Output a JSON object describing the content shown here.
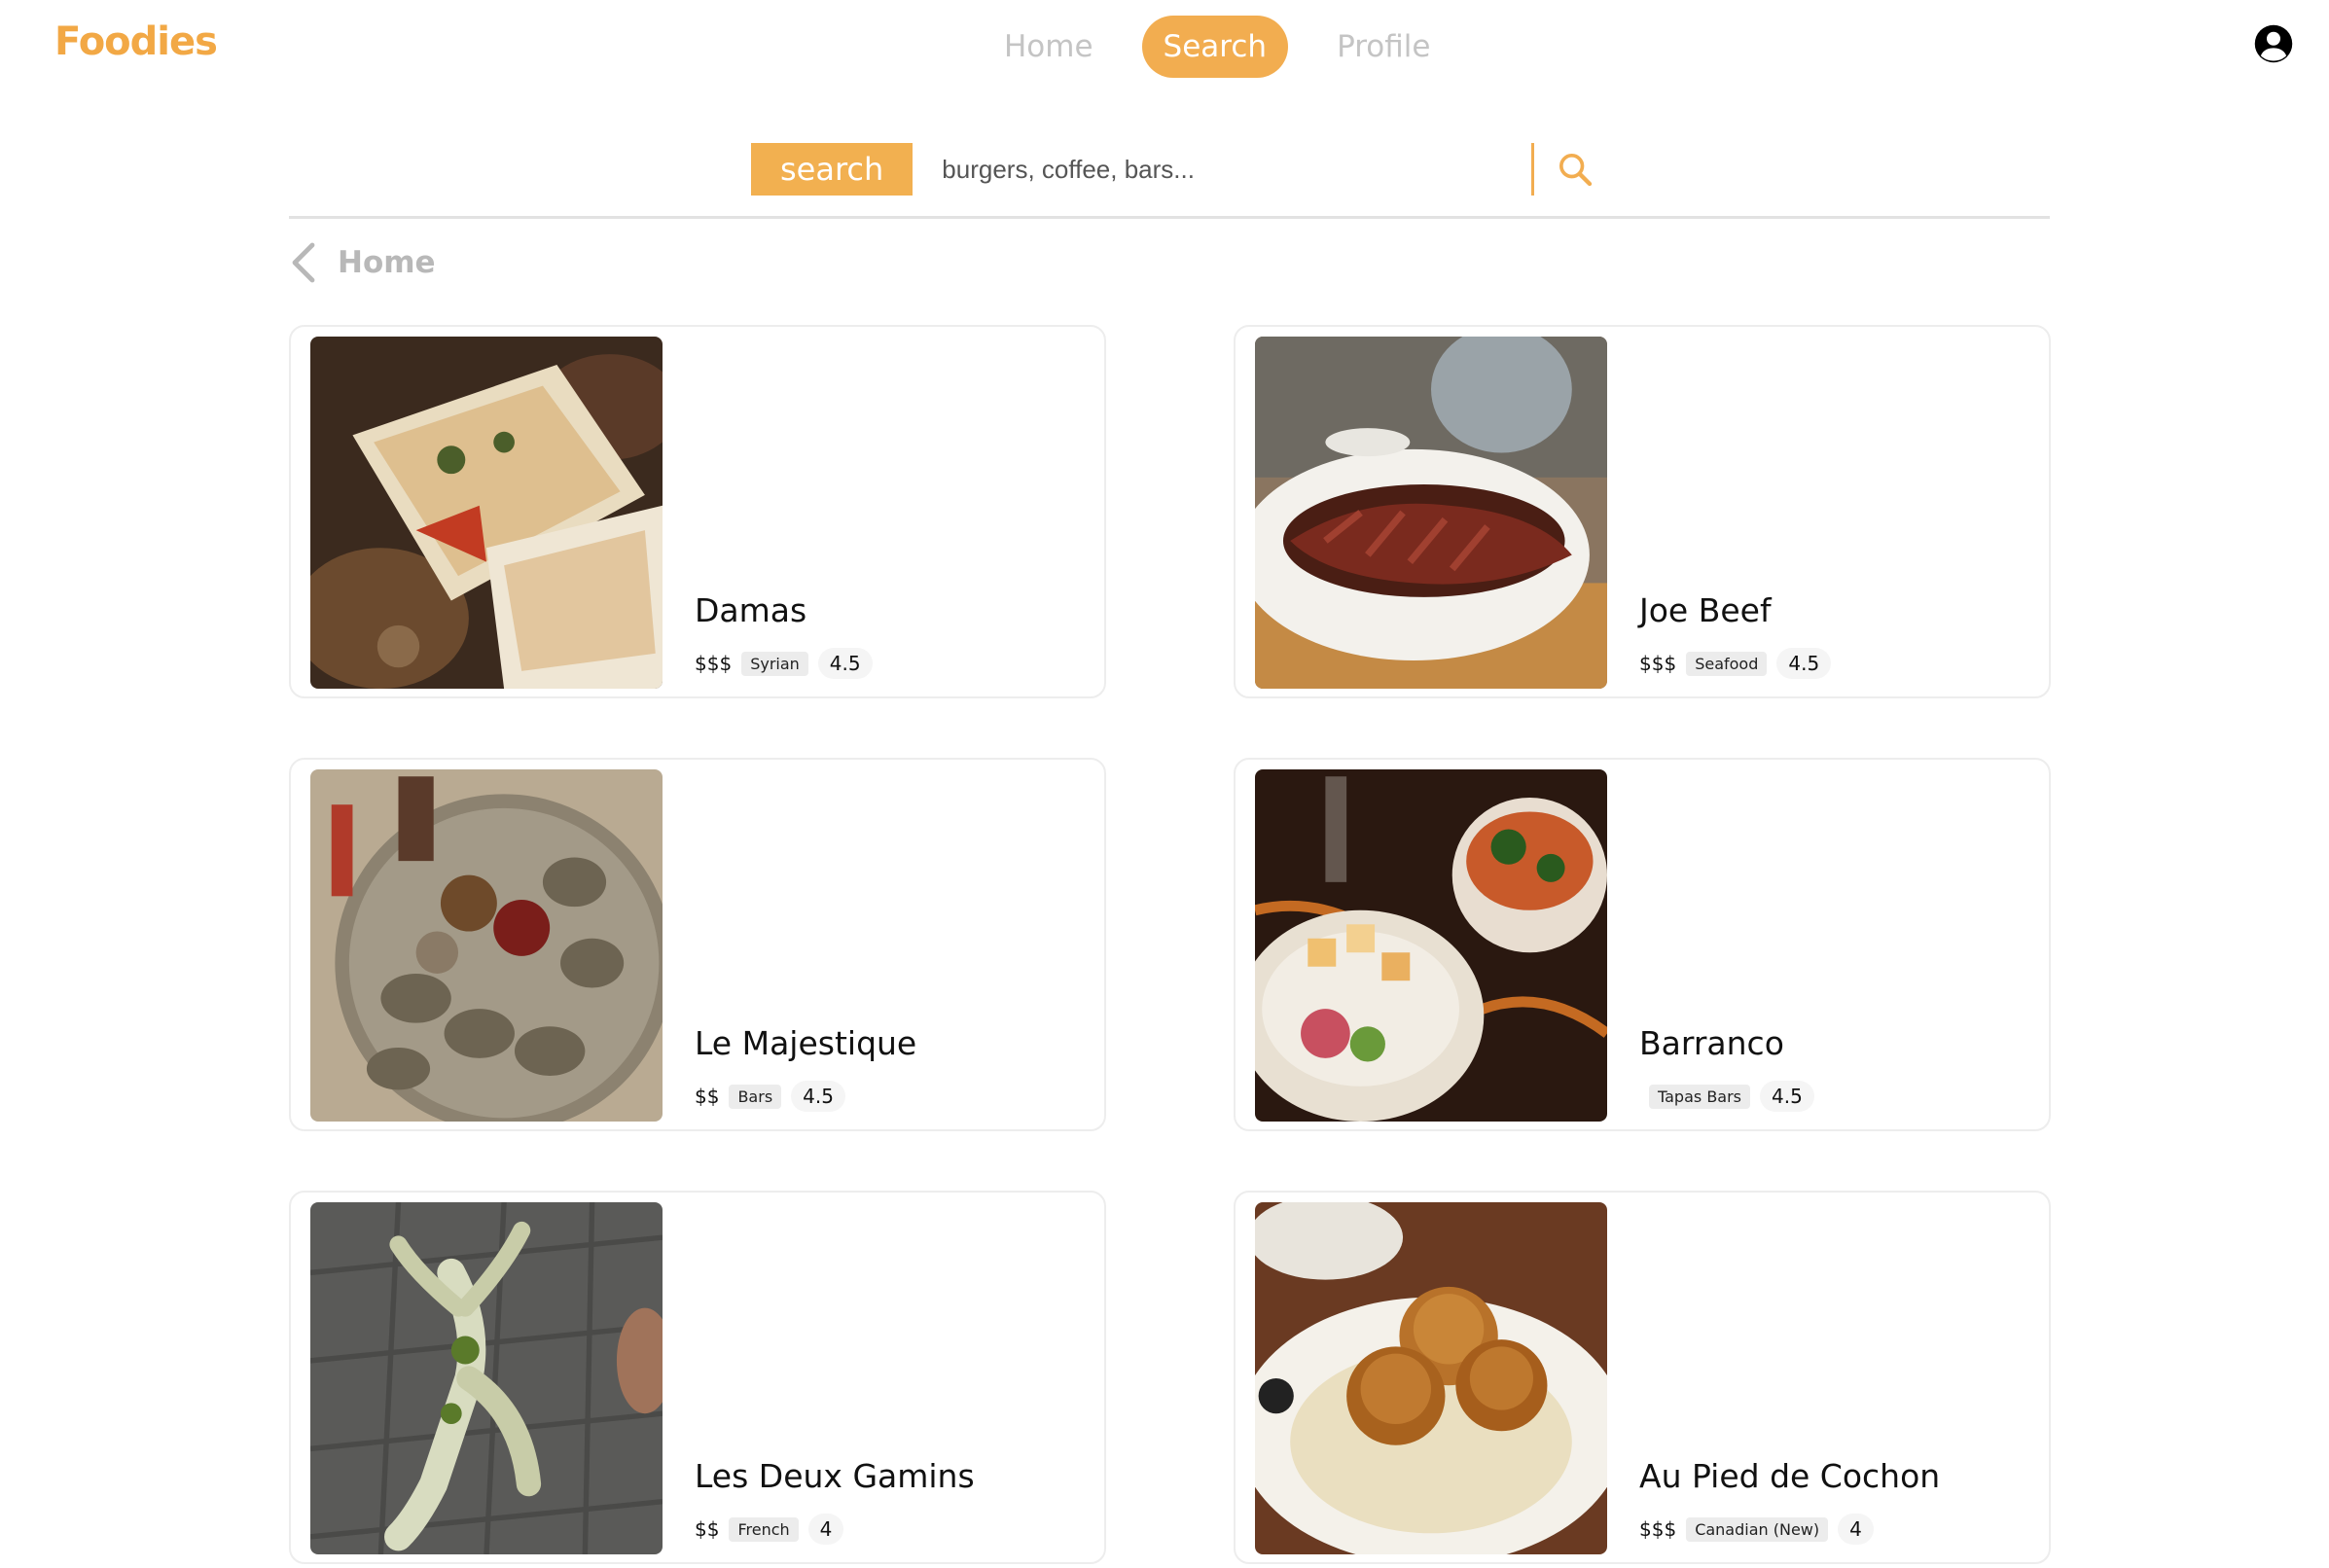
{
  "header": {
    "logo": "Foodies",
    "nav": [
      {
        "label": "Home",
        "active": false
      },
      {
        "label": "Search",
        "active": true
      },
      {
        "label": "Profile",
        "active": false
      }
    ],
    "avatar_icon": "account-circle-icon"
  },
  "search": {
    "button_label": "search",
    "placeholder": "burgers, coffee, bars...",
    "icon": "search-icon",
    "accent_color": "#f2ad50"
  },
  "breadcrumb": {
    "label": "Home",
    "icon": "chevron-left-icon"
  },
  "restaurants": [
    {
      "name": "Damas",
      "price": "$$$",
      "category": "Syrian",
      "rating": "4.5"
    },
    {
      "name": "Joe Beef",
      "price": "$$$",
      "category": "Seafood",
      "rating": "4.5"
    },
    {
      "name": "Le Majestique",
      "price": "$$",
      "category": "Bars",
      "rating": "4.5"
    },
    {
      "name": "Barranco",
      "price": "",
      "category": "Tapas Bars",
      "rating": "4.5"
    },
    {
      "name": "Les Deux Gamins",
      "price": "$$",
      "category": "French",
      "rating": "4"
    },
    {
      "name": "Au Pied de Cochon",
      "price": "$$$",
      "category": "Canadian (New)",
      "rating": "4"
    }
  ],
  "colors": {
    "brand": "#f2a845",
    "nav_inactive": "#c4c4c4",
    "breadcrumb": "#b8b8b8"
  }
}
